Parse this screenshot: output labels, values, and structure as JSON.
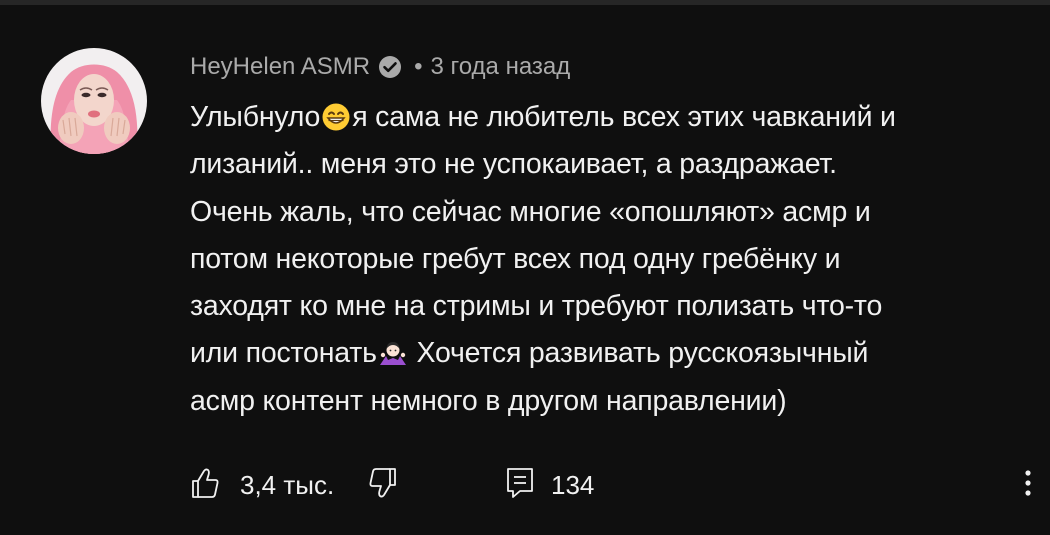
{
  "comment": {
    "author": "HeyHelen ASMR",
    "verified": true,
    "separator": "•",
    "time_ago": "3 года назад",
    "lines": [
      {
        "before": "Улыбнуло",
        "emoji": "grinning-face-emoji",
        "after": "я сама не любитель всех этих чавканий и"
      },
      {
        "text": "лизаний.. меня это не успокаивает, а раздражает."
      },
      {
        "text": "Очень жаль, что сейчас многие «опошляют» асмр и"
      },
      {
        "text": "потом некоторые гребут всех под одну гребёнку и"
      },
      {
        "text": "заходят ко мне на стримы и требуют полизать что-то"
      },
      {
        "before": "или постонать",
        "emoji": "woman-shrugging-emoji",
        "after": " Хочется развивать русскоязычный"
      },
      {
        "text": "асмр контент немного в другом направлении)"
      }
    ]
  },
  "actions": {
    "like_count": "3,4 тыс.",
    "reply_count": "134"
  },
  "icons": {
    "like": "thumbs-up-icon",
    "dislike": "thumbs-down-icon",
    "reply": "reply-icon",
    "more": "more-vertical-icon",
    "verified": "verified-check-icon"
  },
  "colors": {
    "background": "#0f0f0f",
    "text": "#f1f1f1",
    "secondary_text": "#aaaaaa"
  }
}
